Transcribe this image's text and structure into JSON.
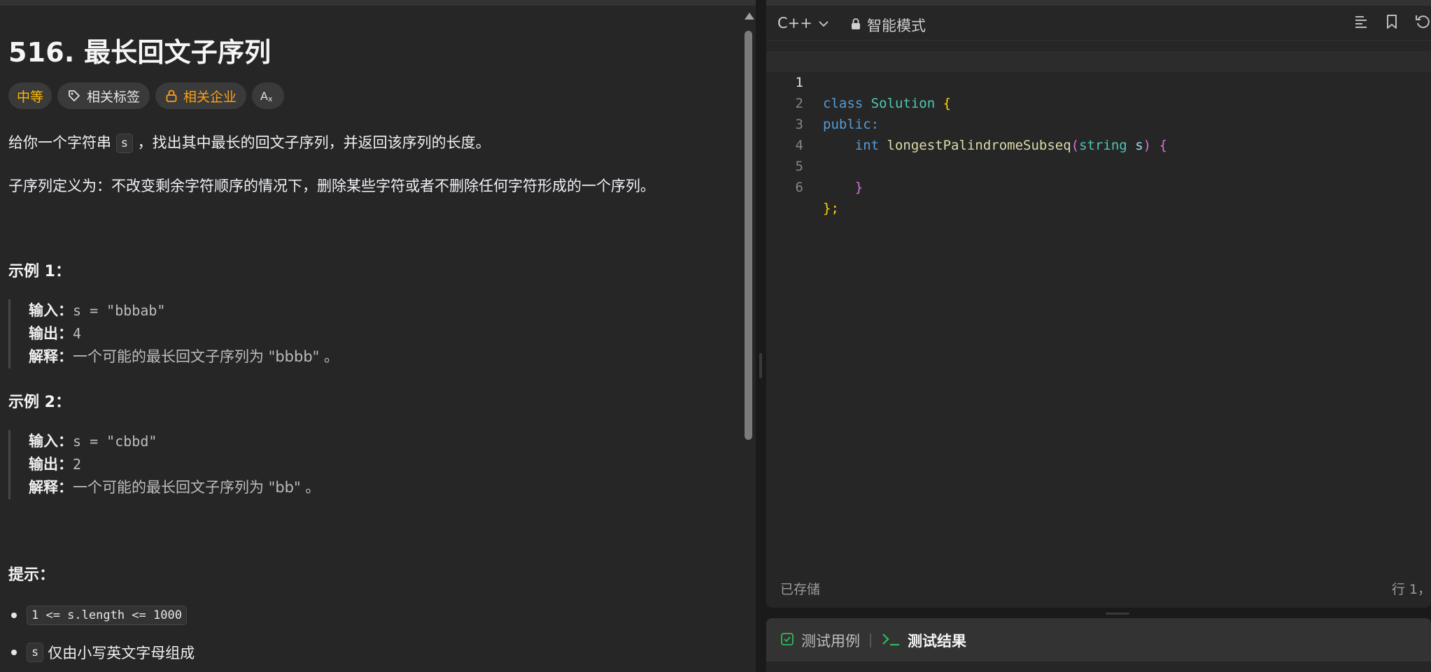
{
  "problem": {
    "title": "516. 最长回文子序列",
    "tags": {
      "difficulty": "中等",
      "related_tags": "相关标签",
      "related_companies": "相关企业"
    },
    "desc_p1_before": "给你一个字符串 ",
    "desc_p1_code": "s",
    "desc_p1_after": " ，找出其中最长的回文子序列，并返回该序列的长度。",
    "desc_p2": "子序列定义为：不改变剩余字符顺序的情况下，删除某些字符或者不删除任何字符形成的一个序列。",
    "examples": [
      {
        "heading": "示例 1：",
        "input_label": "输入：",
        "input_value": "s = \"bbbab\"",
        "output_label": "输出：",
        "output_value": "4",
        "explain_label": "解释：",
        "explain_value": "一个可能的最长回文子序列为 \"bbbb\" 。"
      },
      {
        "heading": "示例 2：",
        "input_label": "输入：",
        "input_value": "s = \"cbbd\"",
        "output_label": "输出：",
        "output_value": "2",
        "explain_label": "解释：",
        "explain_value": "一个可能的最长回文子序列为 \"bb\" 。"
      }
    ],
    "hints_heading": "提示：",
    "constraint1_code": "1 <= s.length <= 1000",
    "constraint2_code": "s",
    "constraint2_text": "仅由小写英文字母组成"
  },
  "editor": {
    "language": "C++",
    "mode": "智能模式",
    "line_numbers": [
      "1",
      "2",
      "3",
      "4",
      "5",
      "6"
    ],
    "code": {
      "l1_kw": "class",
      "l1_ty": "Solution",
      "l1_br": "{",
      "l2_kw": "public:",
      "l3_ty": "int",
      "l3_fn": "longestPalindromeSubseq",
      "l3_paren_open": "(",
      "l3_pty": "string",
      "l3_va": "s",
      "l3_paren_close": ")",
      "l3_br": "{",
      "l5_br": "}",
      "l6_br": "};"
    },
    "status_saved": "已存储",
    "cursor_position": "行 1，"
  },
  "test_panel": {
    "tab_cases": "测试用例",
    "tab_results": "测试结果"
  },
  "colors": {
    "accent_orange": "#ffa116",
    "difficulty_medium": "#ffb800",
    "success_green": "#2cbb5d"
  }
}
